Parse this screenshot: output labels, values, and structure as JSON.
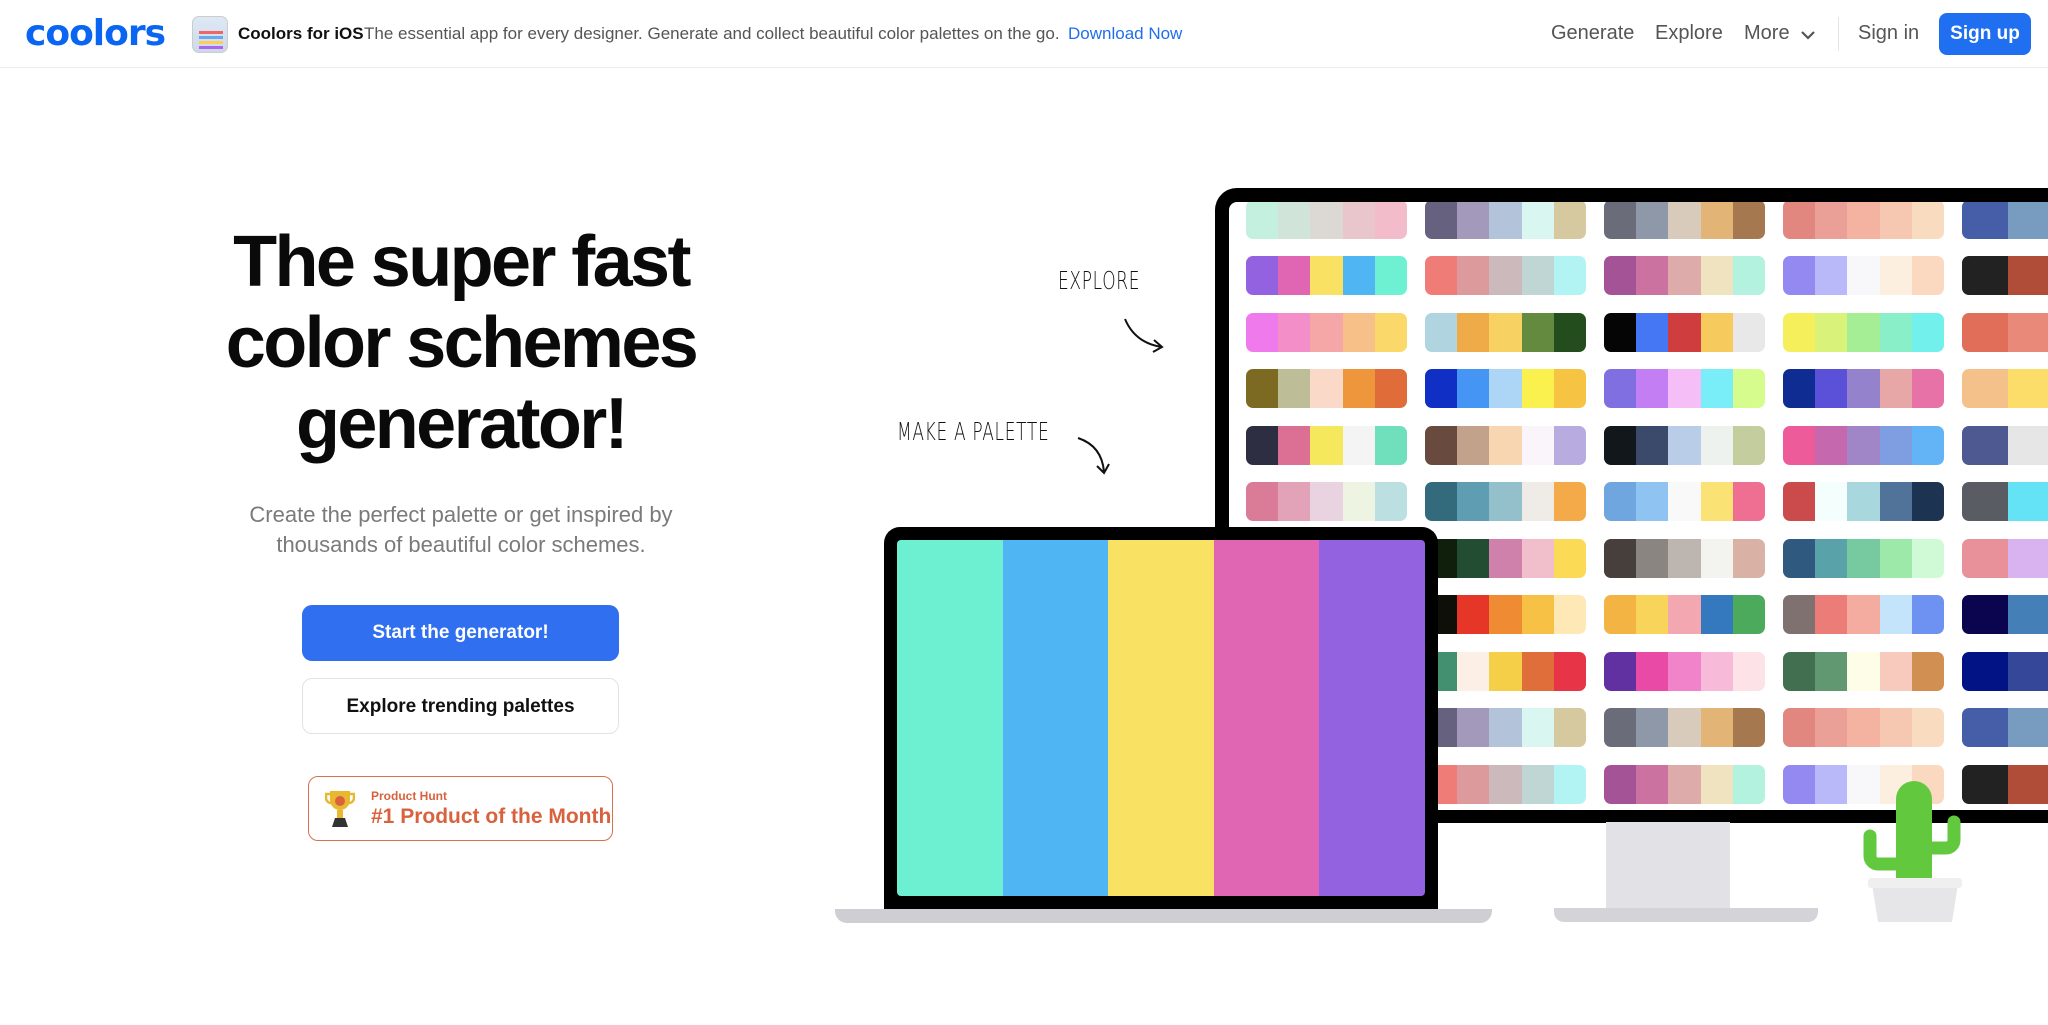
{
  "header": {
    "logo": "coolors",
    "ios_title": "Coolors for iOS",
    "ios_desc": "The essential app for every designer. Generate and collect beautiful color palettes on the go.",
    "ios_link": "Download Now",
    "nav": [
      "Generate",
      "Explore",
      "More"
    ],
    "sign_in": "Sign in",
    "sign_up": "Sign up"
  },
  "hero": {
    "headline": [
      "The super fast",
      "color schemes",
      "generator!"
    ],
    "subtitle": [
      "Create the perfect palette or get inspired by",
      "thousands of beautiful color schemes."
    ],
    "start_button": "Start the generator!",
    "explore_button": "Explore trending palettes",
    "badge_small": "Product Hunt",
    "badge_big": "#1 Product of the Month"
  },
  "illustration": {
    "explore_label": "EXPLORE",
    "make_label": "MAKE A PALETTE",
    "laptop_palette": [
      "#6df0d2",
      "#4fb6f3",
      "#f8e163",
      "#e065b3",
      "#9262e0"
    ],
    "palette_columns": [
      [
        [
          "#c4f0df",
          "#d0e4da",
          "#dcd9d5",
          "#e8c6cc",
          "#f2bccb"
        ],
        [
          "#9262e0",
          "#e065b3",
          "#f8e163",
          "#4fb6f3",
          "#6ef0d2"
        ],
        [
          "#ef7aeb",
          "#f48ec8",
          "#f5a6a6",
          "#f6c088",
          "#fad86a"
        ],
        [
          "#7c6a23",
          "#bdbd98",
          "#fbd9c8",
          "#ee963b",
          "#e06c3a"
        ],
        [
          "#2e2e42",
          "#dc6f94",
          "#f6e85d",
          "#f4f4f4",
          "#6fdfbc"
        ],
        [
          "#da7b98",
          "#e2a3b9",
          "#ead3e1",
          "#eef4e2",
          "#bcdfe2"
        ]
      ],
      [
        [
          "#66617f",
          "#a399ba",
          "#b3c3da",
          "#d9f7f0",
          "#d6c99f"
        ],
        [
          "#f07c78",
          "#dd9a9d",
          "#ccb9bb",
          "#bfd6d4",
          "#b2f3f3"
        ],
        [
          "#b0d4e0",
          "#eeab47",
          "#f7d263",
          "#648a3f",
          "#234d1c"
        ],
        [
          "#102fc5",
          "#4595f5",
          "#add5f5",
          "#fbf14e",
          "#f6c343"
        ],
        [
          "#684a3f",
          "#c2a28a",
          "#f9d6b2",
          "#faf5fa",
          "#b8abe0"
        ],
        [
          "#336b7c",
          "#5f9db2",
          "#94c0cc",
          "#efebe7",
          "#f4aa48"
        ],
        [
          "#0f1f0b",
          "#224d32",
          "#cf80ab",
          "#f0bfcb",
          "#fbda55"
        ],
        [
          "#0f0f0a",
          "#e63628",
          "#ef8c33",
          "#f6c144",
          "#fde8b6"
        ],
        [
          "#42906f",
          "#fcf0e6",
          "#f6cf48",
          "#e06e3a",
          "#e73447"
        ],
        [
          "#66617f",
          "#a399ba",
          "#b3c3da",
          "#d9f7f0",
          "#d6c99f"
        ],
        [
          "#f07c78",
          "#dd9a9d",
          "#ccb9bb",
          "#bfd6d4",
          "#b2f3f3"
        ]
      ],
      [
        [
          "#6a6c7a",
          "#8f98a8",
          "#d8cbbb",
          "#e2b476",
          "#a5784f"
        ],
        [
          "#a45496",
          "#cb72a0",
          "#ddabaa",
          "#f0e3c0",
          "#b2f2df"
        ],
        [
          "#050505",
          "#4577f4",
          "#cf3d3e",
          "#f7ca5e",
          "#e8e8e8"
        ],
        [
          "#7f6fe0",
          "#c37ef4",
          "#f5bef6",
          "#79eef8",
          "#d5fc8d"
        ],
        [
          "#12171c",
          "#3b4a6b",
          "#b9cde8",
          "#edf2ee",
          "#c4cd9d"
        ],
        [
          "#6fa6e0",
          "#8fc4f2",
          "#f9f9f9",
          "#fbe274",
          "#ee6f91"
        ],
        [
          "#463f3b",
          "#8a8580",
          "#bcb5b0",
          "#f3f3ef",
          "#d9b1a5"
        ],
        [
          "#f3b443",
          "#f8d45b",
          "#f3a7b1",
          "#3479bd",
          "#4caa5d"
        ],
        [
          "#6131a1",
          "#e94aa6",
          "#f183cb",
          "#f7bad9",
          "#fde2e8"
        ],
        [
          "#6a6c7a",
          "#8f98a8",
          "#d8cbbb",
          "#e2b476",
          "#a5784f"
        ],
        [
          "#a45496",
          "#cb72a0",
          "#ddabaa",
          "#f0e3c0",
          "#b2f2df"
        ]
      ],
      [
        [
          "#e1877f",
          "#eaa096",
          "#f3b3a0",
          "#f6c7b1",
          "#f9dcbf"
        ],
        [
          "#9488f1",
          "#b9b8f9",
          "#f8f8fb",
          "#fcefe0",
          "#fad9c0"
        ],
        [
          "#f5ef5b",
          "#d8f27a",
          "#a6ee96",
          "#89efc9",
          "#72f0ec"
        ],
        [
          "#0f2c93",
          "#5a51d8",
          "#9482cd",
          "#e6a7a6",
          "#e772a8"
        ],
        [
          "#ed5b9a",
          "#c668ad",
          "#a085c7",
          "#7f9ee2",
          "#62b4f6"
        ],
        [
          "#cb4b4c",
          "#f4fefd",
          "#a9d7de",
          "#527399",
          "#1d3352"
        ],
        [
          "#2f597f",
          "#5aa2a9",
          "#77c99f",
          "#9ce9a9",
          "#cffad5"
        ],
        [
          "#7e716f",
          "#eb7c78",
          "#f4aba0",
          "#c3e4fb",
          "#6d92f1"
        ],
        [
          "#436f51",
          "#619872",
          "#fefee8",
          "#f8cabd",
          "#d18f52"
        ],
        [
          "#e1877f",
          "#eaa096",
          "#f3b3a0",
          "#f6c7b1",
          "#f9dcbf"
        ],
        [
          "#9488f1",
          "#b9b8f9",
          "#f8f8fb",
          "#fcefe0",
          "#fad9c0"
        ]
      ],
      [
        [
          "#465da7",
          "#789bc0",
          "#a5d6ca"
        ],
        [
          "#222222",
          "#b04d38",
          "#8abac0"
        ],
        [
          "#e06e58",
          "#e8897a",
          "#f0aaa0"
        ],
        [
          "#f5c18b",
          "#fcdd6a",
          "#fbecd9"
        ],
        [
          "#4f5991",
          "#e6e6e6",
          "#f2c48c"
        ],
        [
          "#595c63",
          "#63e3f5",
          "#e97650"
        ],
        [
          "#e8919a",
          "#d8b3f0",
          "#f3e77a"
        ],
        [
          "#0b0550",
          "#457fb8",
          "#71ddbd"
        ],
        [
          "#021485",
          "#344798",
          "#6a7fa3"
        ],
        [
          "#465da7",
          "#789bc0",
          "#a5d6ca"
        ],
        [
          "#222222",
          "#b04d38",
          "#8abac0"
        ]
      ]
    ]
  },
  "colors": {
    "brand": "#0a66f2",
    "primary_button": "#2f6ff0",
    "badge": "#d9623e",
    "cactus": "#62c93f"
  }
}
